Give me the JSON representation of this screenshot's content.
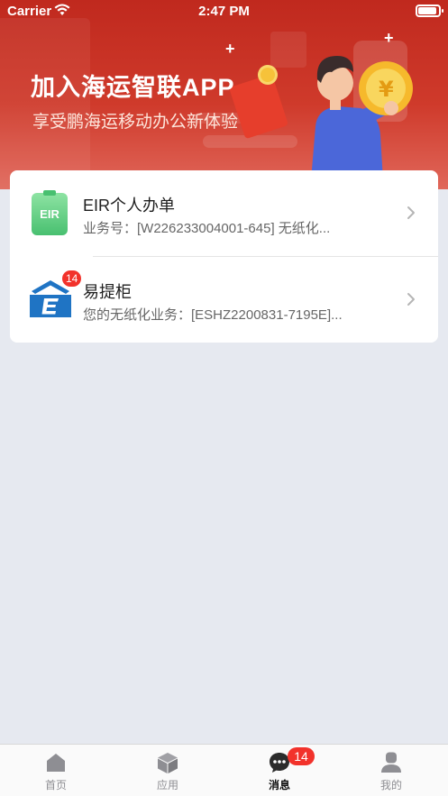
{
  "status_bar": {
    "carrier": "Carrier",
    "time": "2:47 PM"
  },
  "banner": {
    "title": "加入海运智联APP",
    "subtitle": "享受鹏海运移动办公新体验"
  },
  "list": [
    {
      "title": "EIR个人办单",
      "subtitle": "业务号：[W226233004001-645] 无纸化...",
      "icon": "eir-icon",
      "icon_text": "EIR"
    },
    {
      "title": "易提柜",
      "subtitle": "您的无纸化业务：[ESHZ2200831-7195E]...",
      "icon": "yitigui-icon",
      "badge": "14"
    }
  ],
  "tabbar": {
    "tabs": [
      {
        "label": "首页",
        "icon": "home-icon",
        "active": false
      },
      {
        "label": "应用",
        "icon": "box-icon",
        "active": false
      },
      {
        "label": "消息",
        "icon": "message-icon",
        "active": true,
        "badge": "14"
      },
      {
        "label": "我的",
        "icon": "user-icon",
        "active": false
      }
    ]
  },
  "colors": {
    "banner_red": "#c0291e",
    "badge_red": "#f2322b",
    "eir_green": "#48c070",
    "ydg_blue": "#1f74c4",
    "background": "#e6e9f0"
  }
}
